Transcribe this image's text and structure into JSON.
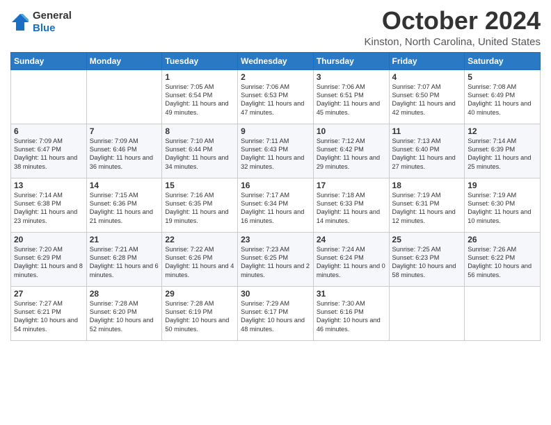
{
  "header": {
    "logo_line1": "General",
    "logo_line2": "Blue",
    "month": "October 2024",
    "location": "Kinston, North Carolina, United States"
  },
  "days_of_week": [
    "Sunday",
    "Monday",
    "Tuesday",
    "Wednesday",
    "Thursday",
    "Friday",
    "Saturday"
  ],
  "weeks": [
    [
      {
        "day": "",
        "text": ""
      },
      {
        "day": "",
        "text": ""
      },
      {
        "day": "1",
        "text": "Sunrise: 7:05 AM\nSunset: 6:54 PM\nDaylight: 11 hours and 49 minutes."
      },
      {
        "day": "2",
        "text": "Sunrise: 7:06 AM\nSunset: 6:53 PM\nDaylight: 11 hours and 47 minutes."
      },
      {
        "day": "3",
        "text": "Sunrise: 7:06 AM\nSunset: 6:51 PM\nDaylight: 11 hours and 45 minutes."
      },
      {
        "day": "4",
        "text": "Sunrise: 7:07 AM\nSunset: 6:50 PM\nDaylight: 11 hours and 42 minutes."
      },
      {
        "day": "5",
        "text": "Sunrise: 7:08 AM\nSunset: 6:49 PM\nDaylight: 11 hours and 40 minutes."
      }
    ],
    [
      {
        "day": "6",
        "text": "Sunrise: 7:09 AM\nSunset: 6:47 PM\nDaylight: 11 hours and 38 minutes."
      },
      {
        "day": "7",
        "text": "Sunrise: 7:09 AM\nSunset: 6:46 PM\nDaylight: 11 hours and 36 minutes."
      },
      {
        "day": "8",
        "text": "Sunrise: 7:10 AM\nSunset: 6:44 PM\nDaylight: 11 hours and 34 minutes."
      },
      {
        "day": "9",
        "text": "Sunrise: 7:11 AM\nSunset: 6:43 PM\nDaylight: 11 hours and 32 minutes."
      },
      {
        "day": "10",
        "text": "Sunrise: 7:12 AM\nSunset: 6:42 PM\nDaylight: 11 hours and 29 minutes."
      },
      {
        "day": "11",
        "text": "Sunrise: 7:13 AM\nSunset: 6:40 PM\nDaylight: 11 hours and 27 minutes."
      },
      {
        "day": "12",
        "text": "Sunrise: 7:14 AM\nSunset: 6:39 PM\nDaylight: 11 hours and 25 minutes."
      }
    ],
    [
      {
        "day": "13",
        "text": "Sunrise: 7:14 AM\nSunset: 6:38 PM\nDaylight: 11 hours and 23 minutes."
      },
      {
        "day": "14",
        "text": "Sunrise: 7:15 AM\nSunset: 6:36 PM\nDaylight: 11 hours and 21 minutes."
      },
      {
        "day": "15",
        "text": "Sunrise: 7:16 AM\nSunset: 6:35 PM\nDaylight: 11 hours and 19 minutes."
      },
      {
        "day": "16",
        "text": "Sunrise: 7:17 AM\nSunset: 6:34 PM\nDaylight: 11 hours and 16 minutes."
      },
      {
        "day": "17",
        "text": "Sunrise: 7:18 AM\nSunset: 6:33 PM\nDaylight: 11 hours and 14 minutes."
      },
      {
        "day": "18",
        "text": "Sunrise: 7:19 AM\nSunset: 6:31 PM\nDaylight: 11 hours and 12 minutes."
      },
      {
        "day": "19",
        "text": "Sunrise: 7:19 AM\nSunset: 6:30 PM\nDaylight: 11 hours and 10 minutes."
      }
    ],
    [
      {
        "day": "20",
        "text": "Sunrise: 7:20 AM\nSunset: 6:29 PM\nDaylight: 11 hours and 8 minutes."
      },
      {
        "day": "21",
        "text": "Sunrise: 7:21 AM\nSunset: 6:28 PM\nDaylight: 11 hours and 6 minutes."
      },
      {
        "day": "22",
        "text": "Sunrise: 7:22 AM\nSunset: 6:26 PM\nDaylight: 11 hours and 4 minutes."
      },
      {
        "day": "23",
        "text": "Sunrise: 7:23 AM\nSunset: 6:25 PM\nDaylight: 11 hours and 2 minutes."
      },
      {
        "day": "24",
        "text": "Sunrise: 7:24 AM\nSunset: 6:24 PM\nDaylight: 11 hours and 0 minutes."
      },
      {
        "day": "25",
        "text": "Sunrise: 7:25 AM\nSunset: 6:23 PM\nDaylight: 10 hours and 58 minutes."
      },
      {
        "day": "26",
        "text": "Sunrise: 7:26 AM\nSunset: 6:22 PM\nDaylight: 10 hours and 56 minutes."
      }
    ],
    [
      {
        "day": "27",
        "text": "Sunrise: 7:27 AM\nSunset: 6:21 PM\nDaylight: 10 hours and 54 minutes."
      },
      {
        "day": "28",
        "text": "Sunrise: 7:28 AM\nSunset: 6:20 PM\nDaylight: 10 hours and 52 minutes."
      },
      {
        "day": "29",
        "text": "Sunrise: 7:28 AM\nSunset: 6:19 PM\nDaylight: 10 hours and 50 minutes."
      },
      {
        "day": "30",
        "text": "Sunrise: 7:29 AM\nSunset: 6:17 PM\nDaylight: 10 hours and 48 minutes."
      },
      {
        "day": "31",
        "text": "Sunrise: 7:30 AM\nSunset: 6:16 PM\nDaylight: 10 hours and 46 minutes."
      },
      {
        "day": "",
        "text": ""
      },
      {
        "day": "",
        "text": ""
      }
    ]
  ]
}
